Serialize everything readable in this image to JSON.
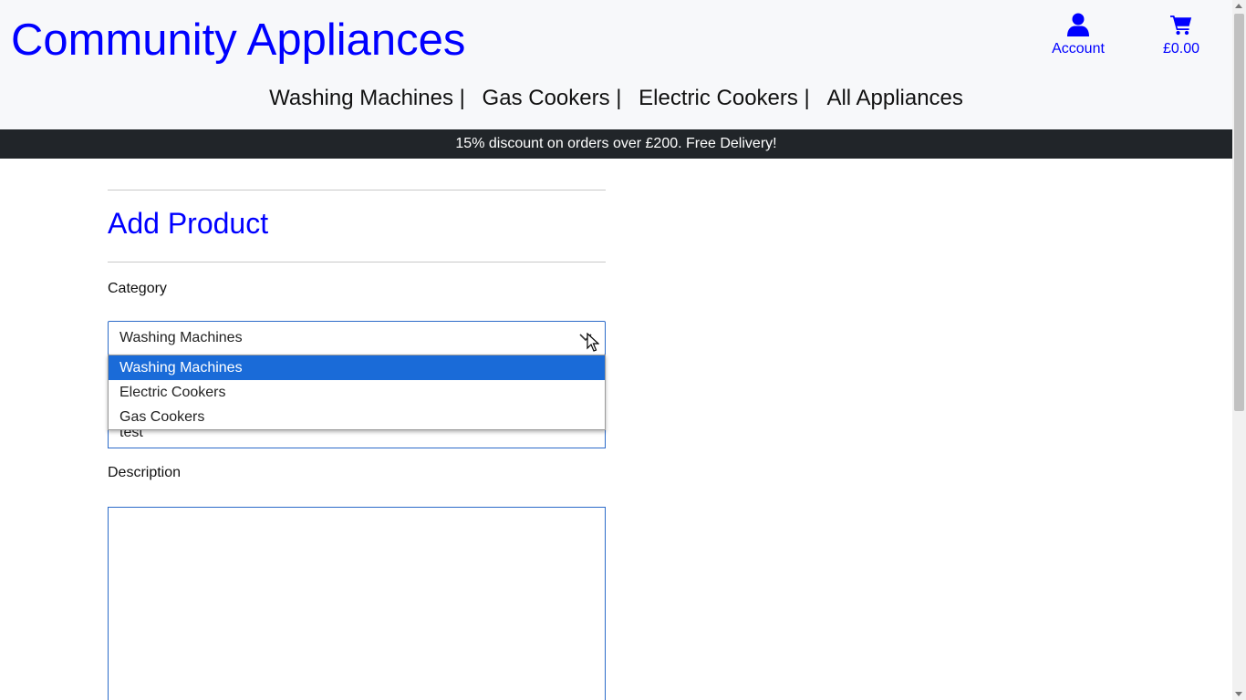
{
  "header": {
    "logo": "Community Appliances",
    "account_label": "Account",
    "basket_total": "£0.00",
    "brand_color": "#0000ff",
    "account_icon": "user-icon",
    "basket_icon": "shopping-cart-icon"
  },
  "nav": {
    "items": [
      "Washing Machines |",
      "Gas Cookers |",
      "Electric Cookers |",
      "All Appliances"
    ]
  },
  "banner": {
    "text": "15% discount on orders over £200. Free Delivery!"
  },
  "form": {
    "title": "Add Product",
    "category_label": "Category",
    "category_value": "Washing Machines",
    "category_options": [
      "Washing Machines",
      "Electric Cookers",
      "Gas Cookers"
    ],
    "name_value": "test",
    "description_label": "Description"
  }
}
